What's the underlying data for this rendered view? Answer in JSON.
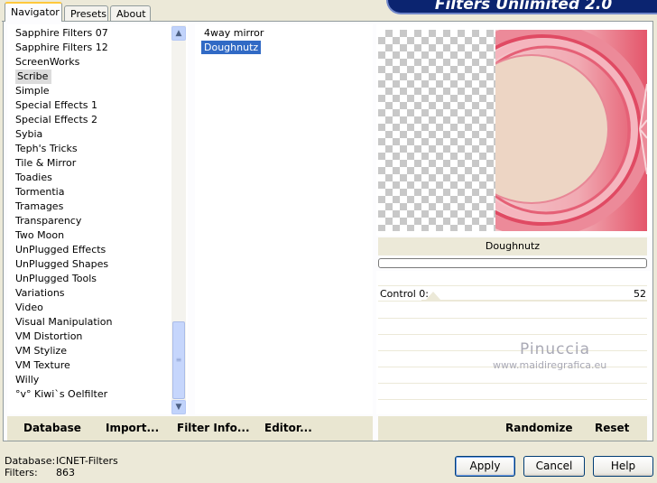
{
  "tabs": [
    {
      "label": "Navigator",
      "active": true
    },
    {
      "label": "Presets",
      "active": false
    },
    {
      "label": "About",
      "active": false
    }
  ],
  "brand_title": "Filters Unlimited 2.0",
  "categories": [
    "Sapphire Filters 07",
    "Sapphire Filters 12",
    "ScreenWorks",
    "Scribe",
    "Simple",
    "Special Effects 1",
    "Special Effects 2",
    "Sybia",
    "Teph's Tricks",
    "Tile & Mirror",
    "Toadies",
    "Tormentia",
    "Tramages",
    "Transparency",
    "Two Moon",
    "UnPlugged Effects",
    "UnPlugged Shapes",
    "UnPlugged Tools",
    "Variations",
    "Video",
    "Visual Manipulation",
    "VM Distortion",
    "VM Stylize",
    "VM Texture",
    "Willy",
    "°v° Kiwi`s Oelfilter"
  ],
  "selected_category": "Scribe",
  "filters": [
    "4way mirror",
    "Doughnutz"
  ],
  "selected_filter": "Doughnutz",
  "filter_name_display": "Doughnutz",
  "controls": [
    {
      "label": "Control 0:",
      "value": "52"
    }
  ],
  "watermark": {
    "title": "Pinuccia",
    "url": "www.maidiregrafica.eu"
  },
  "left_actions": {
    "database": "Database",
    "import": "Import...",
    "filter_info": "Filter Info...",
    "editor": "Editor..."
  },
  "right_actions": {
    "randomize": "Randomize",
    "reset": "Reset"
  },
  "status": {
    "database_label": "Database:",
    "database_value": "ICNET-Filters",
    "filters_label": "Filters:",
    "filters_value": "863"
  },
  "buttons": {
    "apply": "Apply",
    "cancel": "Cancel",
    "help": "Help"
  },
  "colors": {
    "selection": "#316ac5",
    "accent_tab": "#ffc83c",
    "brand": "#0b2470"
  }
}
